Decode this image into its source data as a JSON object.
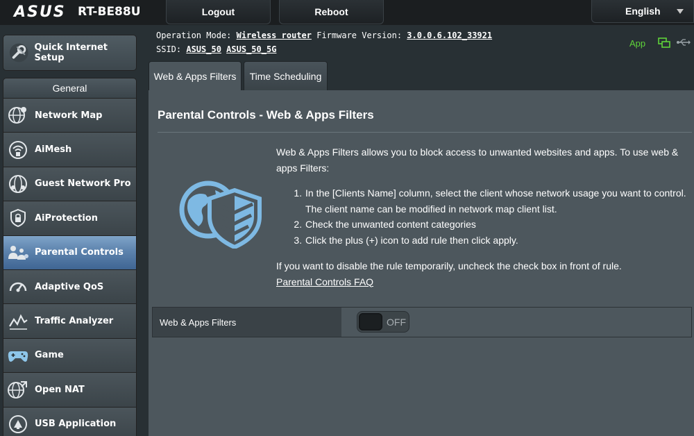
{
  "header": {
    "brand": "ASUS",
    "model": "RT-BE88U",
    "logout_label": "Logout",
    "reboot_label": "Reboot",
    "language": "English"
  },
  "info": {
    "operation_mode_label": "Operation Mode:",
    "operation_mode": "Wireless router",
    "firmware_label": "Firmware Version:",
    "firmware": "3.0.0.6.102_33921",
    "ssid_label": "SSID:",
    "ssid_1": "ASUS_50",
    "ssid_2": "ASUS_50_5G",
    "app_label": "App"
  },
  "sidebar": {
    "qis_label": "Quick Internet Setup",
    "section_label": "General",
    "items": [
      {
        "label": "Network Map",
        "icon": "network-map-icon"
      },
      {
        "label": "AiMesh",
        "icon": "aimesh-icon"
      },
      {
        "label": "Guest Network Pro",
        "icon": "guest-network-icon"
      },
      {
        "label": "AiProtection",
        "icon": "aiprotection-icon"
      },
      {
        "label": "Parental Controls",
        "icon": "parental-controls-icon"
      },
      {
        "label": "Adaptive QoS",
        "icon": "adaptive-qos-icon"
      },
      {
        "label": "Traffic Analyzer",
        "icon": "traffic-analyzer-icon"
      },
      {
        "label": "Game",
        "icon": "game-icon"
      },
      {
        "label": "Open NAT",
        "icon": "open-nat-icon"
      },
      {
        "label": "USB Application",
        "icon": "usb-application-icon"
      }
    ],
    "active_index": 4
  },
  "tabs": [
    {
      "label": "Web & Apps Filters"
    },
    {
      "label": "Time Scheduling"
    }
  ],
  "main": {
    "title": "Parental Controls - Web & Apps Filters",
    "intro": "Web & Apps Filters allows you to block access to unwanted websites and apps. To use web & apps Filters:",
    "steps": [
      "In the [Clients Name] column, select the client whose network usage you want to control. The client name can be modified in network map client list.",
      "Check the unwanted content categories",
      "Click the plus (+) icon to add rule then click apply."
    ],
    "disable_note": "If you want to disable the rule temporarily, uncheck the check box in front of rule.",
    "faq_link": "Parental Controls FAQ",
    "filter_label": "Web & Apps Filters",
    "toggle_state": "OFF"
  },
  "colors": {
    "accent": "#5d83ad",
    "app_green": "#5fd33a",
    "background": "#283034",
    "panel": "#4d575d"
  }
}
